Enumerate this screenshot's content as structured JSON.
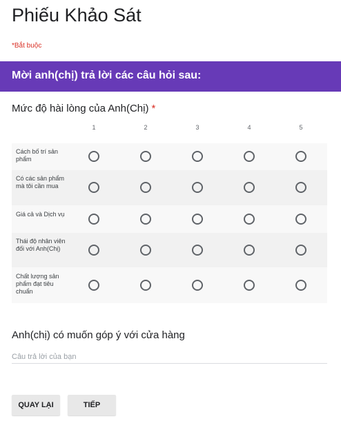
{
  "form": {
    "title": "Phiếu Khảo Sát",
    "required_note": "*Bắt buộc"
  },
  "section": {
    "title": "Mời anh(chị) trả lời các câu hỏi sau:"
  },
  "question1": {
    "title": "Mức độ hài lòng của Anh(Chị)",
    "required_mark": "*",
    "columns": [
      "1",
      "2",
      "3",
      "4",
      "5"
    ],
    "rows": [
      "Cách bố trí sản phẩm",
      "Có các sản phẩm mà tôi cần mua",
      "Giá cả và Dịch vụ",
      "Thái độ nhân viên đối với Anh(Chị)",
      "Chất lượng sản phẩm đạt tiêu chuẩn"
    ]
  },
  "question2": {
    "title": "Anh(chị) có muốn góp ý với cửa hàng",
    "placeholder": "Câu trả lời của bạn",
    "value": ""
  },
  "buttons": {
    "back": "QUAY LẠI",
    "next": "TIẾP"
  },
  "colors": {
    "accent": "#673ab7",
    "required": "#d93025"
  }
}
